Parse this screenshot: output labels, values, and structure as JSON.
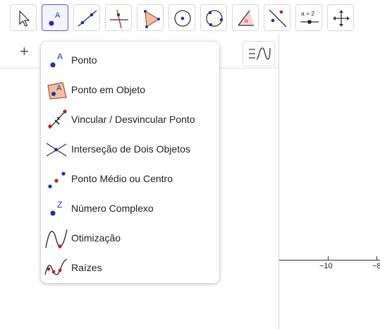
{
  "toolbar": {
    "tools": [
      {
        "name": "move-tool",
        "icon": "arrow-cursor-icon"
      },
      {
        "name": "point-tool",
        "icon": "point-icon"
      },
      {
        "name": "line-tool",
        "icon": "line-icon"
      },
      {
        "name": "perpendicular-tool",
        "icon": "perpendicular-icon"
      },
      {
        "name": "polygon-tool",
        "icon": "polygon-icon"
      },
      {
        "name": "circle-tool",
        "icon": "circle-center-icon"
      },
      {
        "name": "circle-3-points-tool",
        "icon": "circle-points-icon"
      },
      {
        "name": "angle-tool",
        "icon": "angle-icon"
      },
      {
        "name": "reflect-tool",
        "icon": "reflect-icon"
      },
      {
        "name": "slider-tool",
        "icon": "slider-icon",
        "label": "a = 2"
      },
      {
        "name": "move-graphics-tool",
        "icon": "move-arrows-icon"
      }
    ]
  },
  "algebra": {
    "add_icon": "+",
    "menu_icon": "algebra-menu-icon"
  },
  "point_menu": {
    "items": [
      {
        "label": "Ponto",
        "icon": "point-icon"
      },
      {
        "label": "Ponto em Objeto",
        "icon": "point-on-object-icon"
      },
      {
        "label": "Vincular / Desvincular Ponto",
        "icon": "attach-detach-point-icon"
      },
      {
        "label": "Interseção de Dois Objetos",
        "icon": "intersect-icon"
      },
      {
        "label": "Ponto Médio ou Centro",
        "icon": "midpoint-icon"
      },
      {
        "label": "Número Complexo",
        "icon": "complex-number-icon"
      },
      {
        "label": "Otimização",
        "icon": "optimization-icon"
      },
      {
        "label": "Raízes",
        "icon": "roots-icon"
      }
    ]
  },
  "graphics": {
    "x_tick_labels": [
      "−10",
      "−8"
    ]
  },
  "colors": {
    "accent": "#6557d2",
    "point_blue": "#1a33a8",
    "point_red": "#c02020"
  }
}
